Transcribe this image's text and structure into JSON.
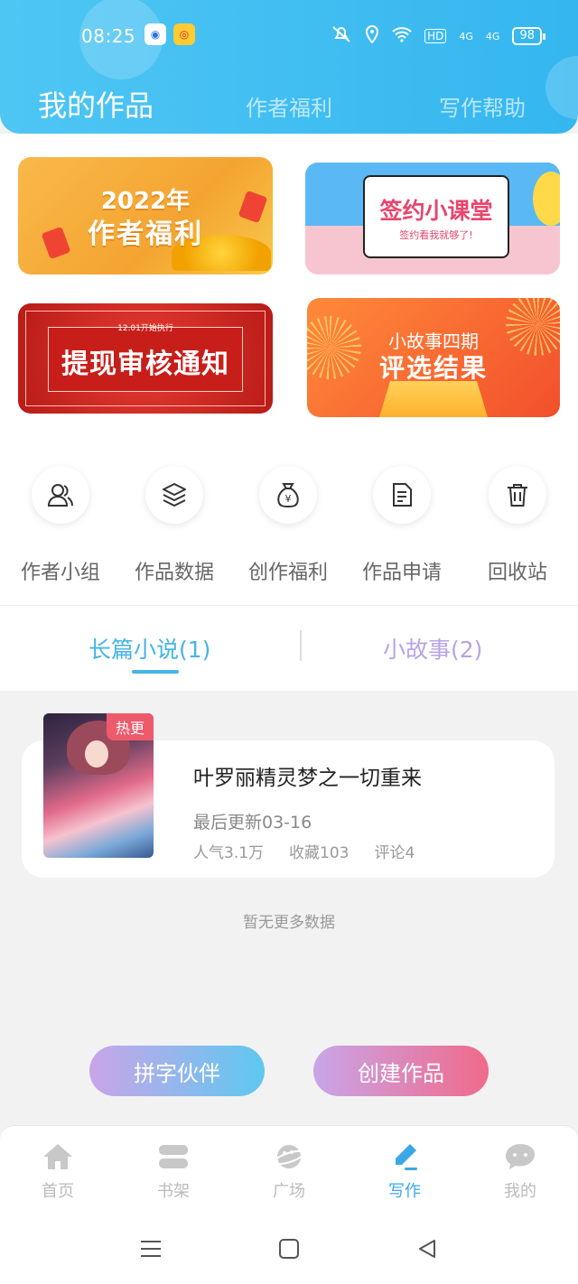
{
  "status_bar": {
    "time": "08:25",
    "battery": "98",
    "network_1": "4G",
    "network_2": "4G",
    "hd": "HD"
  },
  "header": {
    "tabs": [
      {
        "label": "我的作品"
      },
      {
        "label": "作者福利"
      },
      {
        "label": "写作帮助"
      }
    ]
  },
  "banners": [
    {
      "line1": "2022年",
      "line2": "作者福利"
    },
    {
      "title": "签约小课堂",
      "subtitle": "签约看我就够了!"
    },
    {
      "small": "12.01开始执行",
      "title": "提现审核通知"
    },
    {
      "line1": "小故事四期",
      "line2": "评选结果"
    }
  ],
  "quick_actions": [
    {
      "label": "作者小组",
      "icon": "group-icon"
    },
    {
      "label": "作品数据",
      "icon": "layers-icon"
    },
    {
      "label": "创作福利",
      "icon": "money-bag-icon"
    },
    {
      "label": "作品申请",
      "icon": "document-icon"
    },
    {
      "label": "回收站",
      "icon": "trash-icon"
    }
  ],
  "sub_tabs": [
    {
      "label": "长篇小说(1)"
    },
    {
      "label": "小故事(2)"
    }
  ],
  "works": [
    {
      "badge": "热更",
      "title": "叶罗丽精灵梦之一切重来",
      "updated": "最后更新03-16",
      "popularity": "人气3.1万",
      "favorites": "收藏103",
      "comments": "评论4"
    }
  ],
  "empty_hint": "暂无更多数据",
  "actions": {
    "partner_label": "拼字伙伴",
    "create_label": "创建作品"
  },
  "bottom_nav": [
    {
      "label": "首页",
      "icon": "home-icon"
    },
    {
      "label": "书架",
      "icon": "bookshelf-icon"
    },
    {
      "label": "广场",
      "icon": "planet-icon"
    },
    {
      "label": "写作",
      "icon": "pen-icon"
    },
    {
      "label": "我的",
      "icon": "chat-bubble-icon"
    }
  ],
  "colors": {
    "header": "#35b6ef",
    "accent": "#3aa8e6",
    "purple": "#b7a3e6",
    "pink": "#f06a8a"
  }
}
